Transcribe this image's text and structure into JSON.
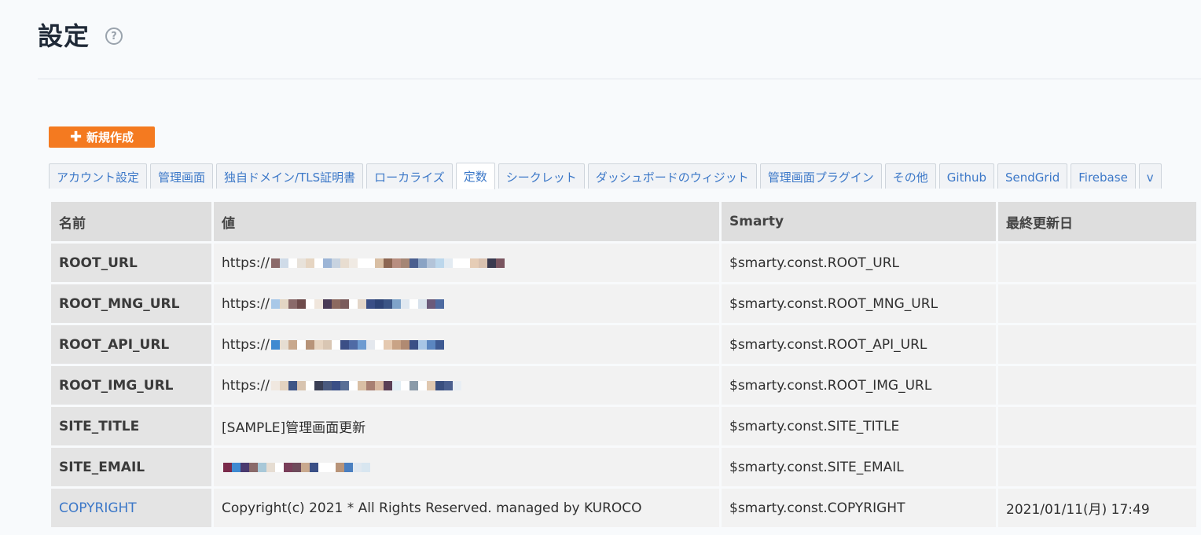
{
  "header": {
    "title": "設定",
    "help_icon": "question-circle-icon"
  },
  "toolbar": {
    "new_label": "新規作成",
    "new_icon": "plus-icon",
    "accent": "#f47a20"
  },
  "tabs": [
    {
      "label": "アカウント設定",
      "active": false
    },
    {
      "label": "管理画面",
      "active": false
    },
    {
      "label": "独自ドメイン/TLS証明書",
      "active": false
    },
    {
      "label": "ローカライズ",
      "active": false
    },
    {
      "label": "定数",
      "active": true
    },
    {
      "label": "シークレット",
      "active": false
    },
    {
      "label": "ダッシュボードのウィジット",
      "active": false
    },
    {
      "label": "管理画面プラグイン",
      "active": false
    },
    {
      "label": "その他",
      "active": false
    },
    {
      "label": "Github",
      "active": false
    },
    {
      "label": "SendGrid",
      "active": false
    },
    {
      "label": "Firebase",
      "active": false
    },
    {
      "label": "v",
      "active": false
    }
  ],
  "table": {
    "headers": [
      "名前",
      "値",
      "Smarty",
      "最終更新日"
    ],
    "rows": [
      {
        "name": "ROOT_URL",
        "value": "https://",
        "smarty": "$smarty.const.ROOT_URL",
        "updated": ""
      },
      {
        "name": "ROOT_MNG_URL",
        "value": "https://",
        "smarty": "$smarty.const.ROOT_MNG_URL",
        "updated": ""
      },
      {
        "name": "ROOT_API_URL",
        "value": "https://",
        "smarty": "$smarty.const.ROOT_API_URL",
        "updated": ""
      },
      {
        "name": "ROOT_IMG_URL",
        "value": "https://",
        "smarty": "$smarty.const.ROOT_IMG_URL",
        "updated": ""
      },
      {
        "name": "SITE_TITLE",
        "value": "[SAMPLE]管理画面更新",
        "smarty": "$smarty.const.SITE_TITLE",
        "updated": ""
      },
      {
        "name": "SITE_EMAIL",
        "value": "",
        "smarty": "$smarty.const.SITE_EMAIL",
        "updated": ""
      },
      {
        "name": "COPYRIGHT",
        "value": "Copyright(c) 2021 * All Rights Reserved. managed by KUROCO",
        "smarty": "$smarty.const.COPYRIGHT",
        "updated": "2021/01/11(月) 17:49",
        "link": true
      }
    ]
  },
  "colors": {
    "link": "#3c78c8",
    "header_bg": "#dedede",
    "cell_bg": "#f2f2f2"
  }
}
